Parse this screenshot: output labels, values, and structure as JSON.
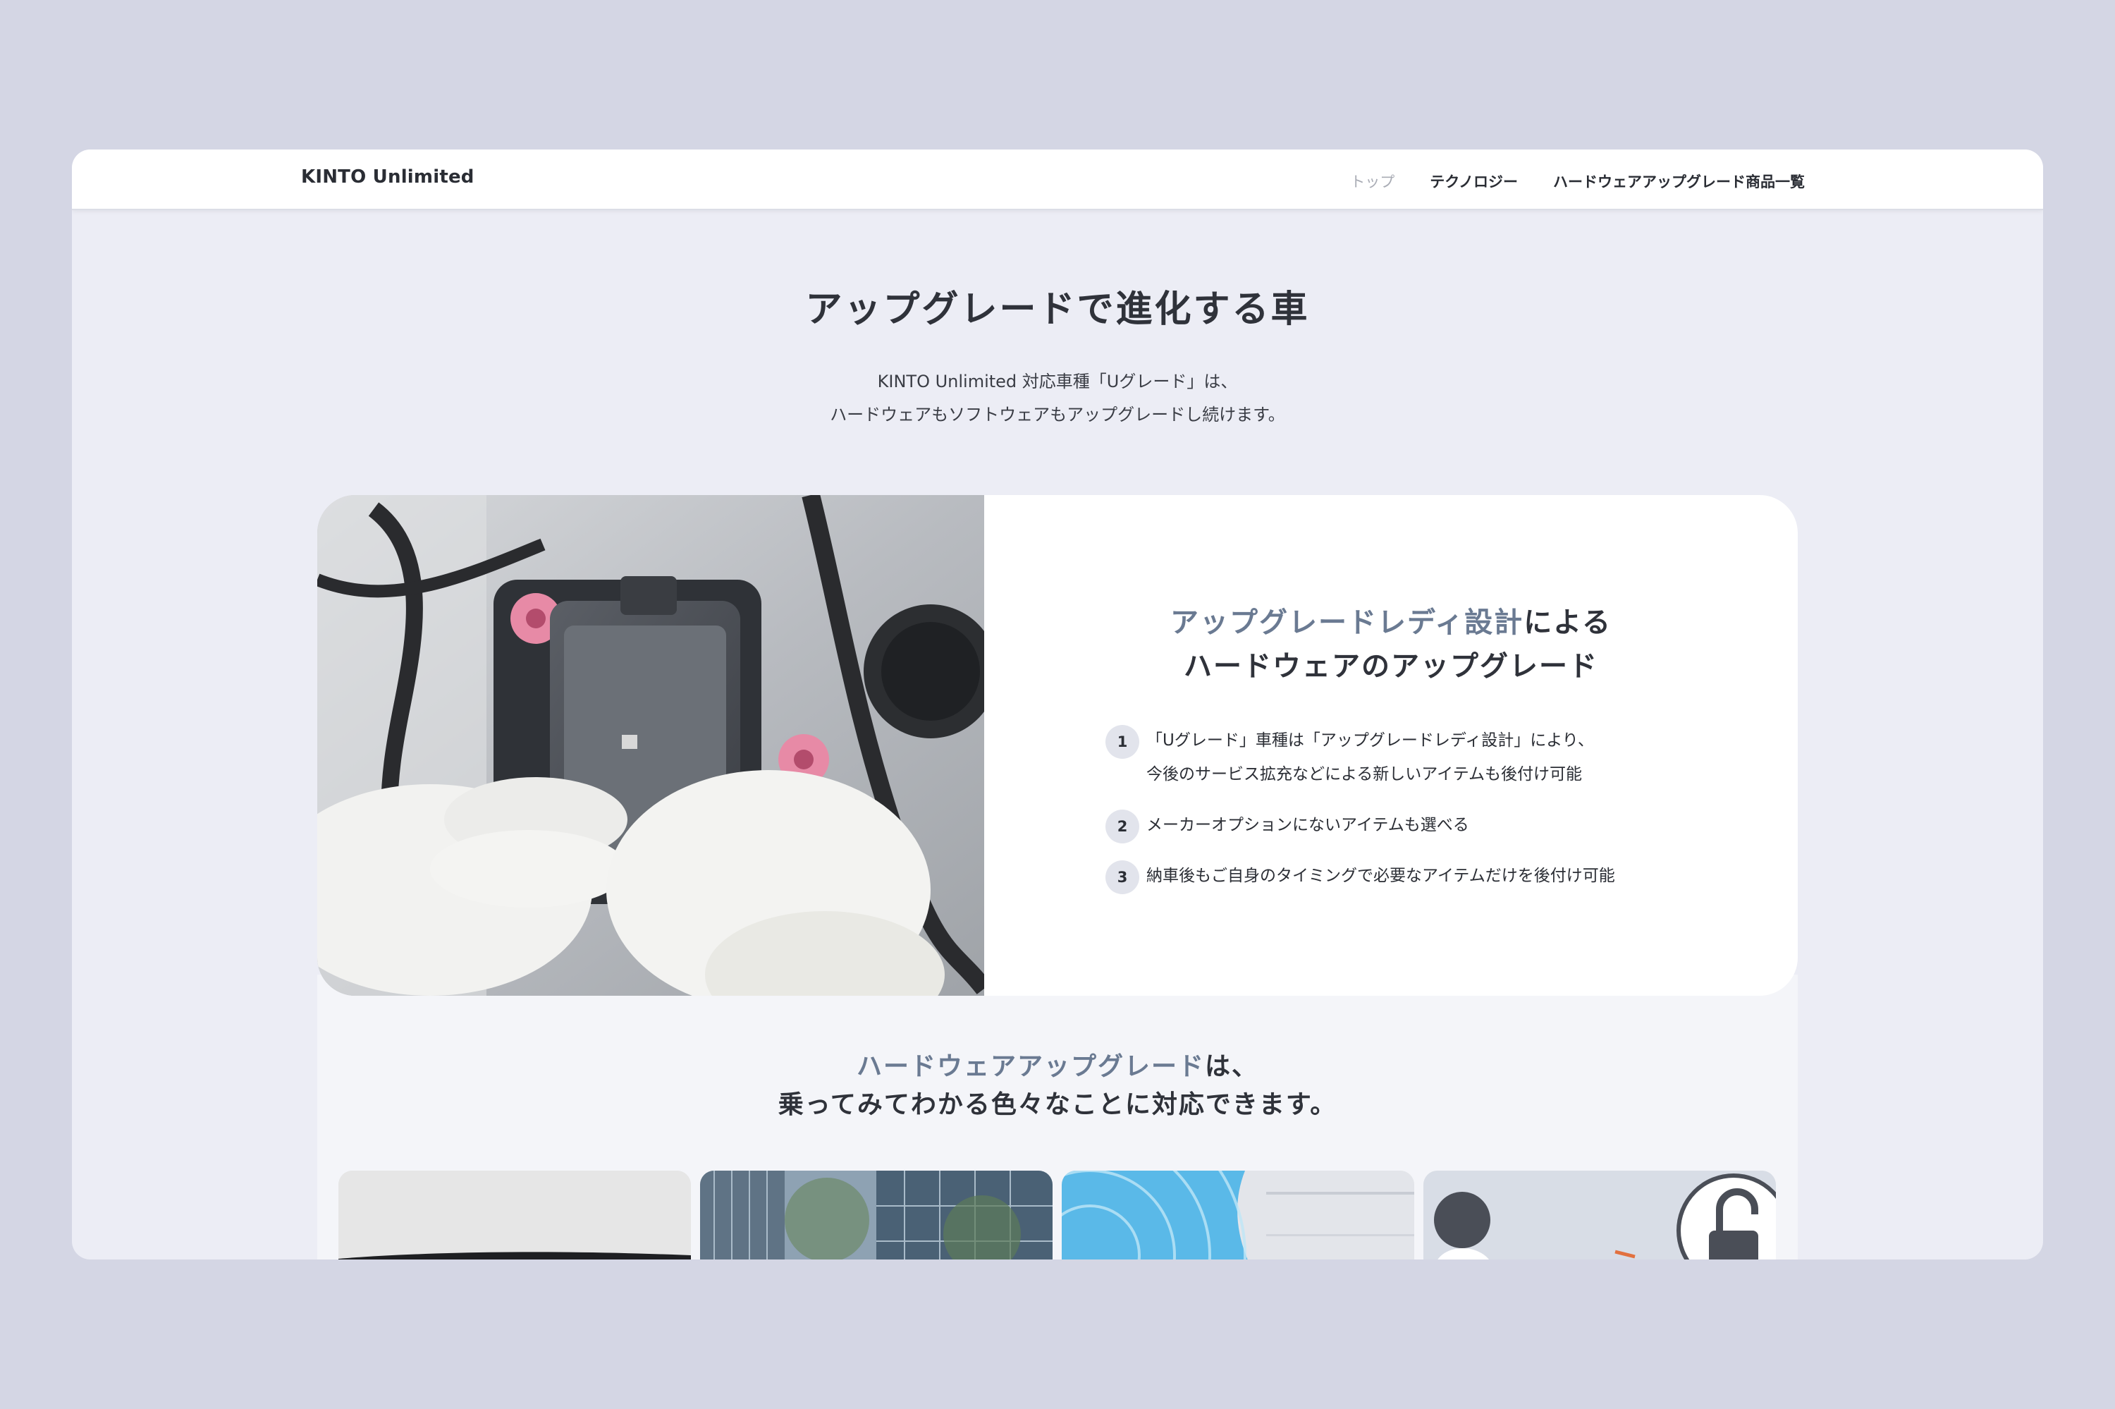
{
  "header": {
    "brand": "KINTO Unlimited",
    "nav": [
      "トップ",
      "テクノロジー",
      "ハードウェアアップグレード商品一覧"
    ]
  },
  "hero": {
    "title": "アップグレードで進化する車",
    "subtitle_lines": [
      "KINTO Unlimited 対応車種「Uグレード」は、",
      "ハードウェアもソフトウェアもアップグレードし続けます。"
    ]
  },
  "feature": {
    "image_icon": "device-install-photo",
    "title_accent": "アップグレードレディ設計",
    "title_rest": "による",
    "title_line2": "ハードウェアのアップグレード",
    "items": [
      {
        "num": "1",
        "lines": [
          "「Uグレード」車種は「アップグレードレディ設計」により、",
          "今後のサービス拡充などによる新しいアイテムも後付け可能"
        ]
      },
      {
        "num": "2",
        "lines": [
          "メーカーオプションにないアイテムも選べる"
        ]
      },
      {
        "num": "3",
        "lines": [
          "納車後もご自身のタイミングで必要なアイテムだけを後付け可能"
        ]
      }
    ]
  },
  "section2": {
    "accent": "ハードウェアアップグレード",
    "rest": "は、",
    "line2": "乗ってみてわかる色々なことに対応できます。"
  },
  "cards": [
    {
      "icon": "car-photo"
    },
    {
      "icon": "building-photo"
    },
    {
      "icon": "sensor-wave-photo"
    },
    {
      "icon": "lock-illustration"
    }
  ],
  "colors": {
    "accent": "#6a7a92",
    "background": "#d4d6e4",
    "page": "#ecedf5"
  }
}
